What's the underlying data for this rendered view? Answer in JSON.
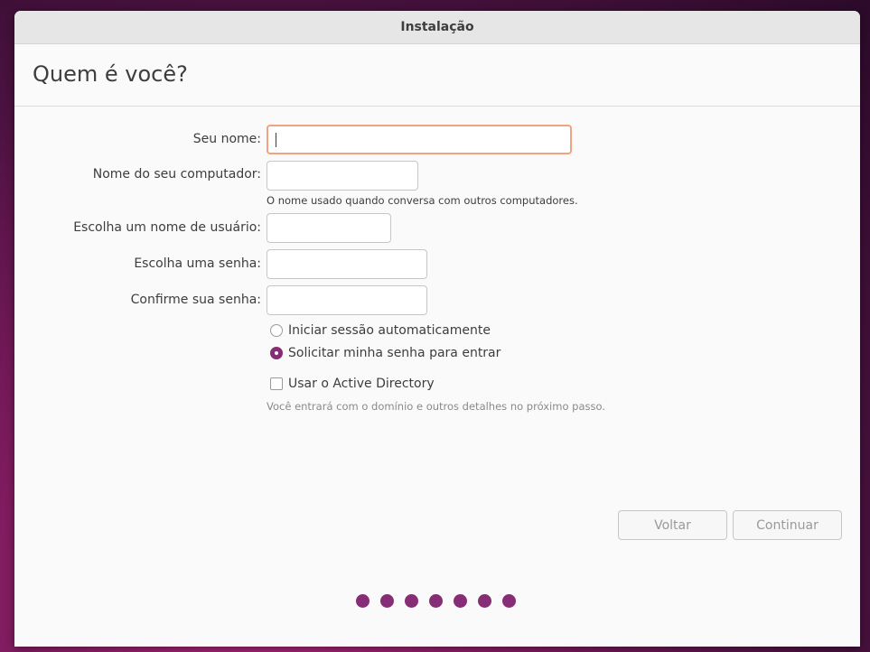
{
  "window": {
    "title": "Instalação"
  },
  "page": {
    "title": "Quem é você?"
  },
  "form": {
    "name_label": "Seu nome:",
    "name_value": "",
    "computer_label": "Nome do seu computador:",
    "computer_value": "",
    "computer_hint": "O nome usado quando conversa com outros computadores.",
    "username_label": "Escolha um nome de usuário:",
    "username_value": "",
    "password_label": "Escolha uma senha:",
    "password_value": "",
    "confirm_label": "Confirme sua senha:",
    "confirm_value": ""
  },
  "login_options": [
    {
      "label": "Iniciar sessão automaticamente",
      "selected": false
    },
    {
      "label": "Solicitar minha senha para entrar",
      "selected": true
    }
  ],
  "active_directory": {
    "label": "Usar o Active Directory",
    "checked": false,
    "hint": "Você entrará com o domínio e outros detalhes no próximo passo."
  },
  "buttons": {
    "back": "Voltar",
    "continue": "Continuar"
  },
  "progress": {
    "total_steps": 7,
    "accent_color": "#862d75"
  },
  "colors": {
    "accent": "#862d75",
    "focus_border": "#f0a37e"
  }
}
